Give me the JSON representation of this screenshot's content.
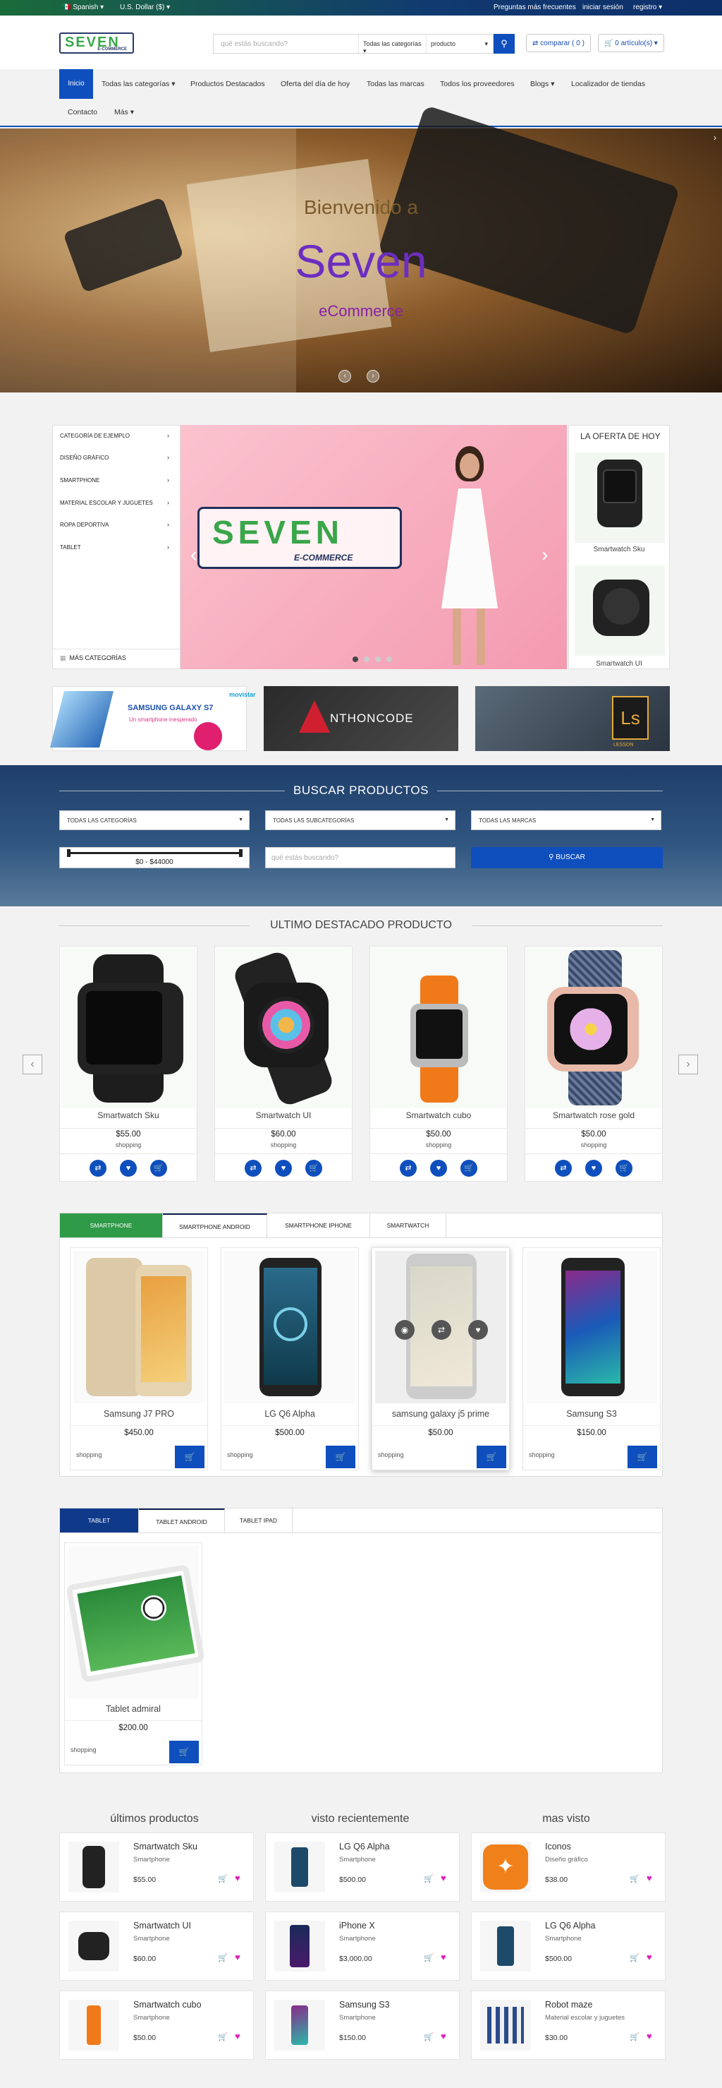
{
  "topbar": {
    "language": "Spanish",
    "currency": "U.S. Dollar ($)",
    "faq": "Preguntas más frecuentes",
    "login": "iniciar sesión",
    "register": "registro"
  },
  "header": {
    "logo_text": "SEVEN",
    "logo_sub": "E-COMMERCE",
    "search_placeholder": "qué estás buscando?",
    "category_select": "Todas las categorías",
    "type_select": "producto",
    "compare": "comparar ( 0 )",
    "cart": "0 artículo(s)"
  },
  "nav": {
    "items": [
      "Inicio",
      "Todas las categorías",
      "Productos Destacados",
      "Oferta del día de hoy",
      "Todas las marcas",
      "Todos los proveedores",
      "Blogs",
      "Localizador de tiendas",
      "Contacto",
      "Más"
    ]
  },
  "hero": {
    "line1": "Bienvenido a",
    "line2": "Seven",
    "line3": "eCommerce"
  },
  "categories": {
    "items": [
      "CATEGORÍA DE EJEMPLO",
      "DISEÑO GRÁFICO",
      "SMARTPHONE",
      "MATERIAL ESCOLAR Y JUGUETES",
      "ROPA DEPORTIVA",
      "TABLET"
    ],
    "more": "MÁS CATEGORÍAS"
  },
  "banner": {
    "logo_text": "SEVEN",
    "logo_sub": "E-COMMERCE"
  },
  "deal": {
    "title": "LA OFERTA DE HOY",
    "products": [
      "Smartwatch Sku",
      "Smartwatch UI"
    ]
  },
  "promos": {
    "p1_title": "SAMSUNG GALAXY S7",
    "p1_sub": "Un smartphone inesperado",
    "p1_brand": "movistar",
    "p2_text": "NTHONCODE",
    "p3_text": "Ls",
    "p3_sub": "LESSON"
  },
  "buscar": {
    "title": "BUSCAR PRODUCTOS",
    "cat": "TODAS LAS CATEGORÍAS",
    "subcat": "TODAS LAS SUBCATEGORÍAS",
    "brand": "TODAS LAS MARCAS",
    "range": "$0 - $44000",
    "placeholder": "qué estás buscando?",
    "button": "BUSCAR"
  },
  "featured": {
    "title": "ULTIMO DESTACADO PRODUCTO",
    "products": [
      {
        "name": "Smartwatch Sku",
        "price": "$55.00",
        "tag": "shopping"
      },
      {
        "name": "Smartwatch UI",
        "price": "$60.00",
        "tag": "shopping"
      },
      {
        "name": "Smartwatch cubo",
        "price": "$50.00",
        "tag": "shopping"
      },
      {
        "name": "Smartwatch rose gold",
        "price": "$50.00",
        "tag": "shopping"
      }
    ]
  },
  "phones": {
    "tabs": [
      "SMARTPHONE",
      "SMARTPHONE ANDROID",
      "SMARTPHONE IPHONE",
      "SMARTWATCH"
    ],
    "products": [
      {
        "name": "Samsung J7 PRO",
        "price": "$450.00",
        "tag": "shopping"
      },
      {
        "name": "LG Q6 Alpha",
        "price": "$500.00",
        "tag": "shopping"
      },
      {
        "name": "samsung galaxy j5 prime",
        "price": "$50.00",
        "tag": "shopping"
      },
      {
        "name": "Samsung S3",
        "price": "$150.00",
        "tag": "shopping"
      }
    ]
  },
  "tablets": {
    "tabs": [
      "TABLET",
      "TABLET ANDROID",
      "TABLET IPAD"
    ],
    "products": [
      {
        "name": "Tablet admiral",
        "price": "$200.00",
        "tag": "shopping"
      }
    ]
  },
  "lists": {
    "latest": {
      "title": "últimos productos",
      "items": [
        {
          "name": "Smartwatch Sku",
          "cat": "Smartphone",
          "price": "$55.00"
        },
        {
          "name": "Smartwatch UI",
          "cat": "Smartphone",
          "price": "$60.00"
        },
        {
          "name": "Smartwatch cubo",
          "cat": "Smartphone",
          "price": "$50.00"
        }
      ]
    },
    "recent": {
      "title": "visto recientemente",
      "items": [
        {
          "name": "LG Q6 Alpha",
          "cat": "Smartphone",
          "price": "$500.00"
        },
        {
          "name": "iPhone X",
          "cat": "Smartphone",
          "price": "$3,000.00"
        },
        {
          "name": "Samsung S3",
          "cat": "Smartphone",
          "price": "$150.00"
        }
      ]
    },
    "most": {
      "title": "mas visto",
      "items": [
        {
          "name": "Iconos",
          "cat": "Diseño gráfico",
          "price": "$38.00"
        },
        {
          "name": "LG Q6 Alpha",
          "cat": "Smartphone",
          "price": "$500.00"
        },
        {
          "name": "Robot maze",
          "cat": "Material escolar y juguetes",
          "price": "$30.00"
        }
      ]
    }
  },
  "colors": {
    "primary": "#0f4fbd",
    "green": "#2f9a47",
    "heart": "#e01fb8"
  }
}
